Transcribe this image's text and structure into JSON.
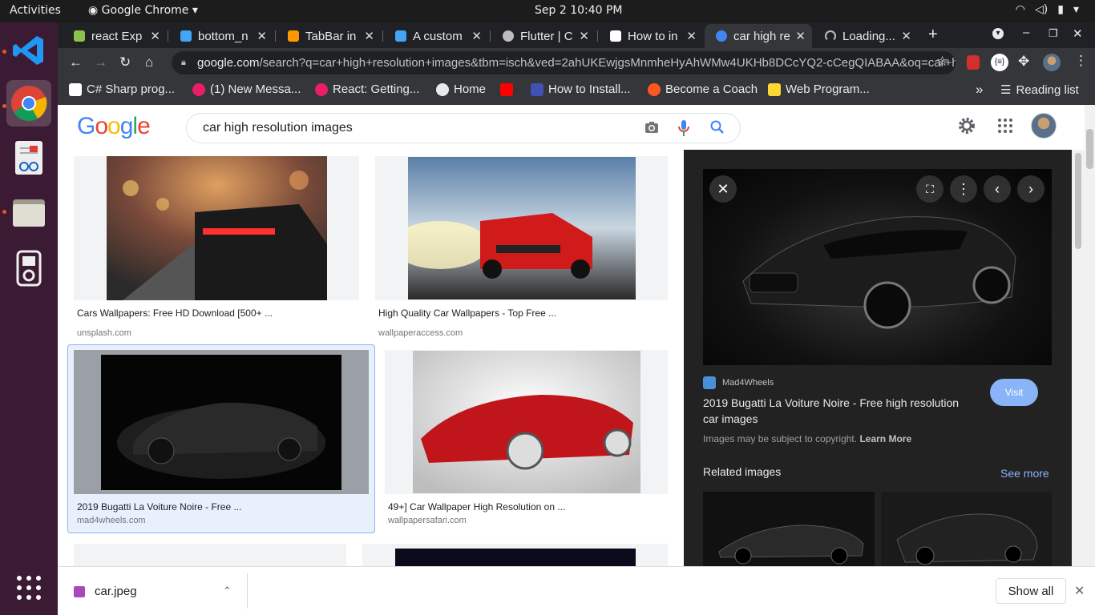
{
  "system": {
    "activities": "Activities",
    "app_name": "Google Chrome",
    "datetime": "Sep 2  10:40 PM"
  },
  "tabs": [
    {
      "title": "react Exp",
      "color": "#8bc34a"
    },
    {
      "title": "bottom_n",
      "color": "#42a5f5"
    },
    {
      "title": "TabBar in",
      "color": "#ff9800"
    },
    {
      "title": "A custom",
      "color": "#42a5f5"
    },
    {
      "title": "Flutter | C",
      "color": "#bdbdbd"
    },
    {
      "title": "How to in",
      "color": "#ffffff"
    },
    {
      "title": "car high re",
      "color": "#4285f4",
      "active": true
    },
    {
      "title": "Loading...",
      "color": "#bdbdbd"
    }
  ],
  "address_bar": {
    "domain": "google.com",
    "path": "/search?q=car+high+resolution+images&tbm=isch&ved=2ahUKEwjgsMnmheHyAhWMw4UKHb8DCcYQ2-cCegQIABAA&oq=car+hi..."
  },
  "bookmarks": [
    {
      "label": "C# Sharp prog...",
      "color": "#ffffff"
    },
    {
      "label": "(1) New Messa...",
      "color": "#e91e63"
    },
    {
      "label": "React: Getting...",
      "color": "#e91e63"
    },
    {
      "label": "Home",
      "color": "#e8eaed"
    },
    {
      "label": "How to Install...",
      "color": "#ff0000"
    },
    {
      "label": "Become a Coach",
      "color": "#ff5722"
    },
    {
      "label": "Web Program...",
      "color": "#fdd835"
    }
  ],
  "bookmarks_more": "»",
  "reading_list": "Reading list",
  "google": {
    "logo": "Google",
    "query": "car high resolution images"
  },
  "results": [
    {
      "title": "Cars Wallpapers: Free HD Download [500+ ...",
      "source": "unsplash.com"
    },
    {
      "title": "High Quality Car Wallpapers - Top Free ...",
      "source": "wallpaperaccess.com"
    },
    {
      "title": "2019 Bugatti La Voiture Noire - Free ...",
      "source": "mad4wheels.com",
      "selected": true
    },
    {
      "title": "49+] Car Wallpaper High Resolution on ...",
      "source": "wallpapersafari.com"
    }
  ],
  "panel": {
    "site": "Mad4Wheels",
    "title_line1": "2019 Bugatti La Voiture Noire - Free high resolution",
    "title_line2": "car images",
    "visit": "Visit",
    "copyright": "Images may be subject to copyright.",
    "learn_more": "Learn More",
    "related": "Related images",
    "see_more": "See more"
  },
  "download": {
    "file": "car.jpeg",
    "show_all": "Show all"
  }
}
